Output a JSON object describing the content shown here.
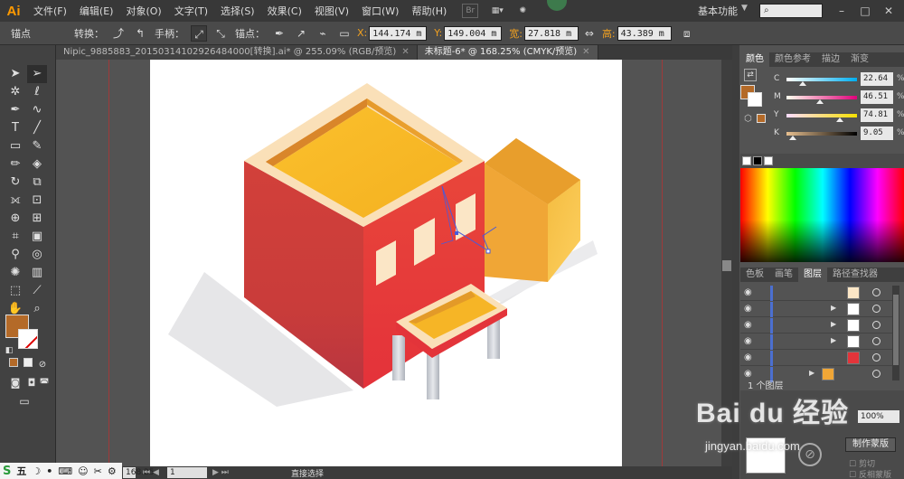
{
  "app": {
    "logo": "Ai",
    "menu": [
      "文件(F)",
      "编辑(E)",
      "对象(O)",
      "文字(T)",
      "选择(S)",
      "效果(C)",
      "视图(V)",
      "窗口(W)",
      "帮助(H)"
    ],
    "bridge": "Br",
    "workspace": "基本功能",
    "window_controls": [
      "–",
      "□",
      "✕"
    ]
  },
  "control_bar": {
    "anchor_label": "锚点",
    "convert_label": "转换：",
    "handle_label": "手柄：",
    "anchor2_label": "锚点：",
    "x_label": "X:",
    "x_value": "144.174 m",
    "y_label": "Y:",
    "y_value": "149.004 m",
    "w_label": "宽:",
    "w_value": "27.818 m",
    "h_label": "高:",
    "h_value": "43.389 m"
  },
  "tabs": [
    {
      "label": "Nipic_9885883_20150314102926484000[转换].ai* @ 255.09% (RGB/预览)",
      "active": false
    },
    {
      "label": "未标题-6* @ 168.25% (CMYK/预览)",
      "active": true
    }
  ],
  "color_panel": {
    "tabs": [
      "颜色",
      "颜色参考",
      "描边",
      "渐变"
    ],
    "fill_color": "#b46a28",
    "channels": [
      {
        "label": "C",
        "value": "22.64",
        "fraction": 0.23,
        "gradient": "linear-gradient(to right,#fff,#00aeef)"
      },
      {
        "label": "M",
        "value": "46.51",
        "fraction": 0.47,
        "gradient": "linear-gradient(to right,#ffe,#e0007a)"
      },
      {
        "label": "Y",
        "value": "74.81",
        "fraction": 0.75,
        "gradient": "linear-gradient(to right,#fdf,#f5e000)"
      },
      {
        "label": "K",
        "value": "9.05",
        "fraction": 0.09,
        "gradient": "linear-gradient(to right,#e8c090,#000)"
      }
    ],
    "percent": "%"
  },
  "layers_panel": {
    "tabs": [
      "色板",
      "画笔",
      "图层",
      "路径查找器"
    ],
    "active_tab": 2,
    "layer_count": "1 个图层"
  },
  "transparency": {
    "opacity": "100%",
    "mask_button": "制作蒙版",
    "clip_label": "剪切",
    "invert_label": "反相蒙版"
  },
  "status_bar": {
    "zoom": "168.25",
    "page": "1",
    "tool_text": "直接选择",
    "ime_items": [
      "S",
      "五",
      "☽",
      "•",
      "⌨",
      "☺",
      "✂",
      "⚙"
    ]
  },
  "watermark": {
    "main": "Bai du 经验",
    "sub": "jingyan.baidu.com"
  }
}
